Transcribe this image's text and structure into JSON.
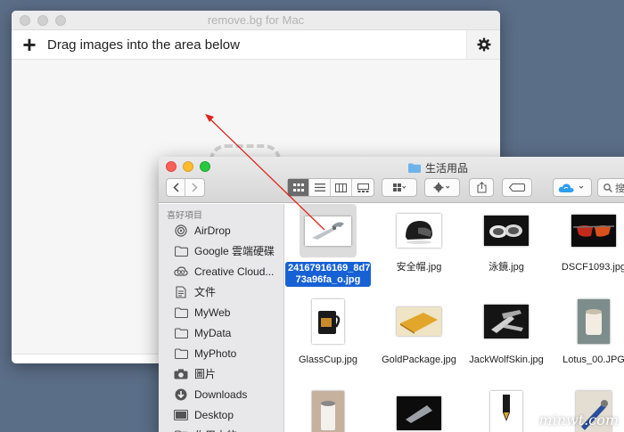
{
  "removebg": {
    "window_title": "remove.bg for Mac",
    "add_symbol": "+",
    "instruction": "Drag images into the area below"
  },
  "finder": {
    "window_title": "生活用品",
    "sidebar_heading": "喜好項目",
    "sidebar": [
      {
        "label": "AirDrop",
        "icon": "airdrop-icon"
      },
      {
        "label": "Google 雲端硬碟",
        "icon": "folder-icon"
      },
      {
        "label": "Creative Cloud...",
        "icon": "creative-cloud-icon"
      },
      {
        "label": "文件",
        "icon": "document-icon"
      },
      {
        "label": "MyWeb",
        "icon": "folder-icon"
      },
      {
        "label": "MyData",
        "icon": "folder-icon"
      },
      {
        "label": "MyPhoto",
        "icon": "folder-icon"
      },
      {
        "label": "圖片",
        "icon": "camera-icon"
      },
      {
        "label": "Downloads",
        "icon": "download-icon"
      },
      {
        "label": "Desktop",
        "icon": "desktop-icon"
      },
      {
        "label": "作用中的...",
        "icon": "folder-icon"
      }
    ],
    "files": [
      {
        "name": "24167916169_8d773a96fa_o.jpg",
        "name_line1": "24167916169_8d7",
        "name_line2": "73a96fa_o.jpg",
        "selected": true
      },
      {
        "name": "安全帽.jpg"
      },
      {
        "name": "泳鏡.jpg"
      },
      {
        "name": "DSCF1093.jpg"
      },
      {
        "name": "GlassCup.jpg"
      },
      {
        "name": "GoldPackage.jpg"
      },
      {
        "name": "JackWolfSkin.jpg"
      },
      {
        "name": "Lotus_00.JPG"
      }
    ],
    "search_char": "搜"
  },
  "watermark": "minwt.com",
  "colors": {
    "selection": "#1761d4",
    "desktop": "#5b6e87",
    "red_light": "#fc5f57",
    "yellow_light": "#fdbc2e",
    "green_light": "#28c840"
  }
}
